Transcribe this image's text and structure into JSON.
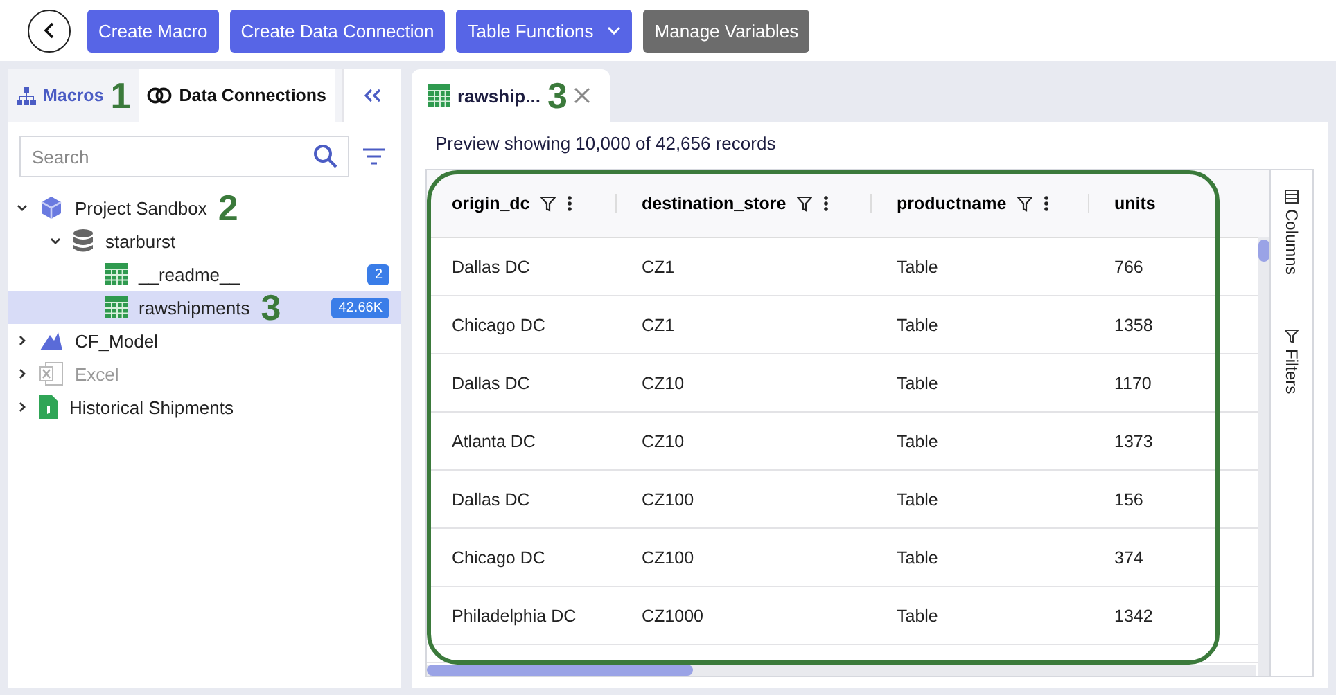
{
  "toolbar": {
    "buttons": [
      {
        "label": "Create Macro",
        "kind": "primary"
      },
      {
        "label": "Create Data Connection",
        "kind": "primary"
      },
      {
        "label": "Table Functions",
        "kind": "dropdown"
      },
      {
        "label": "Manage Variables",
        "kind": "secondary"
      }
    ]
  },
  "sidebar": {
    "tabs": [
      {
        "label": "Macros",
        "selected": false,
        "callout": "1"
      },
      {
        "label": "Data Connections",
        "selected": true
      }
    ],
    "search": {
      "placeholder": "Search"
    },
    "tree": [
      {
        "label": "Project Sandbox",
        "kind": "project",
        "expanded": true,
        "selected": false,
        "disabled": false,
        "callout": "2",
        "children": [
          {
            "label": "starburst",
            "kind": "database",
            "expanded": true,
            "selected": false,
            "disabled": false,
            "children": [
              {
                "label": "__readme__",
                "kind": "table",
                "selected": false,
                "disabled": false,
                "badge": "2"
              },
              {
                "label": "rawshipments",
                "kind": "table",
                "selected": true,
                "disabled": false,
                "badge": "42.66K",
                "callout": "3"
              }
            ]
          }
        ]
      },
      {
        "label": "CF_Model",
        "kind": "model",
        "expanded": false,
        "selected": false,
        "disabled": false
      },
      {
        "label": "Excel",
        "kind": "excel",
        "expanded": false,
        "selected": false,
        "disabled": true
      },
      {
        "label": "Historical Shipments",
        "kind": "file",
        "expanded": false,
        "selected": false,
        "disabled": false
      }
    ]
  },
  "editor": {
    "tabs": [
      {
        "label": "rawship...",
        "selected": true,
        "callout": "3"
      }
    ],
    "preview_text": "Preview showing 10,000 of 42,656 records",
    "table": {
      "highlighted": true,
      "columns": [
        {
          "label": "origin_dc",
          "filter": true,
          "menu": true
        },
        {
          "label": "destination_store",
          "filter": true,
          "menu": true
        },
        {
          "label": "productname",
          "filter": true,
          "menu": true
        },
        {
          "label": "units",
          "filter": false,
          "menu": false
        }
      ],
      "rows": [
        [
          "Dallas DC",
          "CZ1",
          "Table",
          "766"
        ],
        [
          "Chicago DC",
          "CZ1",
          "Table",
          "1358"
        ],
        [
          "Dallas DC",
          "CZ10",
          "Table",
          "1170"
        ],
        [
          "Atlanta DC",
          "CZ10",
          "Table",
          "1373"
        ],
        [
          "Dallas DC",
          "CZ100",
          "Table",
          "156"
        ],
        [
          "Chicago DC",
          "CZ100",
          "Table",
          "374"
        ],
        [
          "Philadelphia DC",
          "CZ1000",
          "Table",
          "1342"
        ]
      ]
    },
    "side_panel": [
      "Columns",
      "Filters"
    ]
  }
}
